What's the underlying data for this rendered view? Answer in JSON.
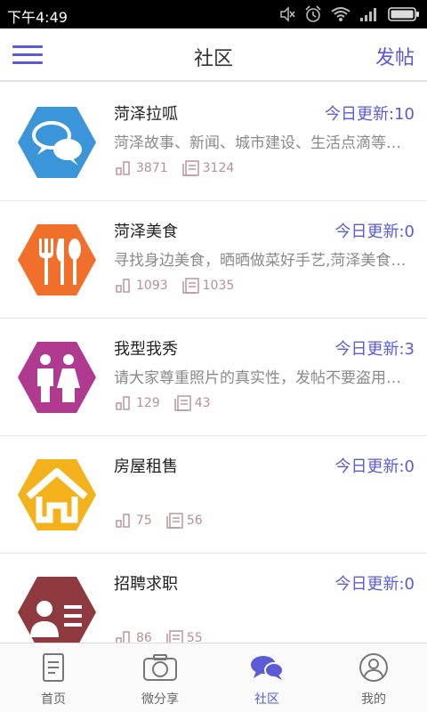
{
  "status_bar": {
    "time": "下午4:49",
    "icons": [
      "mute-icon",
      "alarm-icon",
      "wifi-icon",
      "signal-icon",
      "battery-icon"
    ]
  },
  "header": {
    "title": "社区",
    "post_label": "发帖"
  },
  "forums": [
    {
      "name": "菏泽拉呱",
      "update": "今日更新:10",
      "desc": "菏泽故事、新闻、城市建设、生活点滴等话题讨论",
      "members": "3871",
      "posts": "3124",
      "icon": "chat-bubbles-icon",
      "color": "#3a95d9"
    },
    {
      "name": "菏泽美食",
      "update": "今日更新:0",
      "desc": "寻找身边美食，晒晒做菜好手艺,菏泽美食大家谈",
      "members": "1093",
      "posts": "1035",
      "icon": "cutlery-icon",
      "color": "#ef6f2b"
    },
    {
      "name": "我型我秀",
      "update": "今日更新:3",
      "desc": "请大家尊重照片的真实性，发帖不要盗用他人照片",
      "members": "129",
      "posts": "43",
      "icon": "couple-icon",
      "color": "#b03a8f"
    },
    {
      "name": "房屋租售",
      "update": "今日更新:0",
      "desc": "",
      "members": "75",
      "posts": "56",
      "icon": "house-icon",
      "color": "#f3b21b"
    },
    {
      "name": "招聘求职",
      "update": "今日更新:0",
      "desc": "",
      "members": "86",
      "posts": "55",
      "icon": "id-card-icon",
      "color": "#8e3a3f"
    }
  ],
  "tabs": [
    {
      "label": "首页",
      "icon": "document-icon",
      "active": false
    },
    {
      "label": "微分享",
      "icon": "camera-icon",
      "active": false
    },
    {
      "label": "社区",
      "icon": "chat-bubbles-icon",
      "active": true
    },
    {
      "label": "我的",
      "icon": "user-icon",
      "active": false
    }
  ],
  "colors": {
    "accent": "#5b5bd6",
    "stat_color": "#b88f96",
    "desc_color": "#8a8a8a"
  }
}
